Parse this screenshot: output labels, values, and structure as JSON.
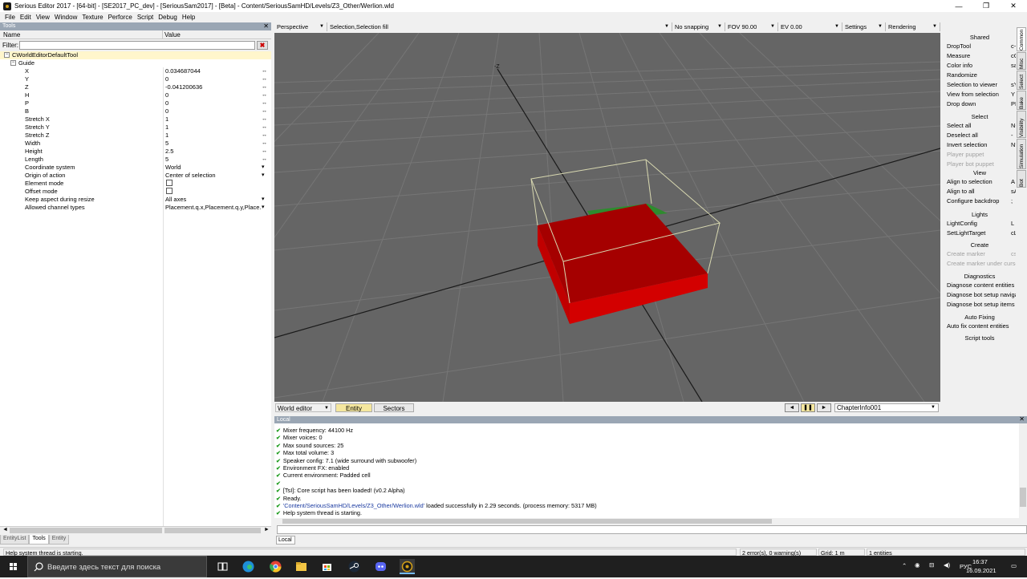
{
  "window": {
    "title": "Serious Editor 2017 - [64-bit] - [SE2017_PC_dev] - [SeriousSam2017] - [Beta] - Content/SeriousSamHD/Levels/Z3_Other/Werlion.wld",
    "minimize": "—",
    "maximize": "❐",
    "close": "✕"
  },
  "menu": [
    "File",
    "Edit",
    "View",
    "Window",
    "Texture",
    "Perforce",
    "Script",
    "Debug",
    "Help"
  ],
  "tools_panel": {
    "title": "Tools",
    "col_name": "Name",
    "col_value": "Value",
    "filter_label": "Filter:",
    "filter_value": "",
    "filter_clear": "✖",
    "root": "CWorldEditorDefaultTool",
    "category": "Guide",
    "properties": [
      {
        "name": "X",
        "value": "0.034687044",
        "arrow": "↔"
      },
      {
        "name": "Y",
        "value": "0",
        "arrow": "↔"
      },
      {
        "name": "Z",
        "value": "-0.041200636",
        "arrow": "↔"
      },
      {
        "name": "H",
        "value": "0",
        "arrow": "↔"
      },
      {
        "name": "P",
        "value": "0",
        "arrow": "↔"
      },
      {
        "name": "B",
        "value": "0",
        "arrow": "↔"
      },
      {
        "name": "Stretch X",
        "value": "1",
        "arrow": "↔"
      },
      {
        "name": "Stretch Y",
        "value": "1",
        "arrow": "↔"
      },
      {
        "name": "Stretch Z",
        "value": "1",
        "arrow": "↔"
      },
      {
        "name": "Width",
        "value": "5",
        "arrow": "↔"
      },
      {
        "name": "Height",
        "value": "2.5",
        "arrow": "↔"
      },
      {
        "name": "Length",
        "value": "5",
        "arrow": "↔"
      },
      {
        "name": "Coordinate system",
        "value": "World",
        "arrow": "▾"
      },
      {
        "name": "Origin of action",
        "value": "Center of selection",
        "arrow": "▾"
      },
      {
        "name": "Element mode",
        "value": "",
        "arrow": "",
        "checkbox": true
      },
      {
        "name": "Offset mode",
        "value": "",
        "arrow": "",
        "checkbox": true
      },
      {
        "name": "Keep aspect during resize",
        "value": "All axes",
        "arrow": "▾"
      },
      {
        "name": "Allowed channel types",
        "value": "Placement.q.x,Placement.q.y,Place...",
        "arrow": "▾"
      }
    ],
    "tabs": [
      "EntityList",
      "Tools",
      "Entity"
    ],
    "active_tab": "Tools"
  },
  "viewport_toolbar": {
    "projection": "Perspective",
    "selection": "Selection,Selection fill",
    "snapping": "No snapping",
    "fov": "FOV 90.00",
    "ev": "EV  0.00",
    "settings": "Settings",
    "rendering": "Rendering",
    "axis_label": "-Z"
  },
  "viewport_bottom": {
    "mode": "World editor",
    "tabs": [
      "Entity",
      "Sectors"
    ],
    "active_tab": "Entity",
    "chapter": "ChapterInfo001",
    "play_prev": "◄",
    "pause": "❚❚",
    "play_next": "►"
  },
  "right_panel": {
    "sections": [
      {
        "header": "Shared",
        "items": [
          {
            "label": "DropTool",
            "shortcut": "c~"
          },
          {
            "label": "Measure",
            "shortcut": "cQ"
          },
          {
            "label": "Color info",
            "shortcut": "sa"
          },
          {
            "label": "Randomize",
            "shortcut": ""
          },
          {
            "label": "Selection to viewer",
            "shortcut": "sY"
          },
          {
            "label": "View from selection",
            "shortcut": "Y"
          },
          {
            "label": "Drop down",
            "shortcut": "PD"
          }
        ]
      },
      {
        "header": "Select",
        "items": [
          {
            "label": "Select all",
            "shortcut": "N+"
          },
          {
            "label": "Deselect all",
            "shortcut": "-"
          },
          {
            "label": "Invert selection",
            "shortcut": "N*"
          },
          {
            "label": "Player puppet",
            "shortcut": "",
            "disabled": true
          },
          {
            "label": "Player bot puppet",
            "shortcut": "",
            "disabled": true
          }
        ]
      },
      {
        "header": "View",
        "items": [
          {
            "label": "Align to selection",
            "shortcut": "A"
          },
          {
            "label": "Align to all",
            "shortcut": "sA"
          },
          {
            "label": "Configure backdrop",
            "shortcut": ";"
          }
        ]
      },
      {
        "header": "Lights",
        "items": [
          {
            "label": "LightConfig",
            "shortcut": "L"
          },
          {
            "label": "SetLightTarget",
            "shortcut": "cL"
          }
        ]
      },
      {
        "header": "Create",
        "items": [
          {
            "label": "Create marker",
            "shortcut": "csC",
            "disabled": true
          },
          {
            "label": "Create marker under cursor",
            "shortcut": "",
            "disabled": true
          }
        ]
      },
      {
        "header": "Diagnostics",
        "items": [
          {
            "label": "Diagnose content entities",
            "shortcut": ""
          },
          {
            "label": "Diagnose bot setup navigation",
            "shortcut": ""
          },
          {
            "label": "Diagnose bot setup items",
            "shortcut": ""
          }
        ]
      },
      {
        "header": "Auto Fixing",
        "items": [
          {
            "label": "Auto fix content entities",
            "shortcut": ""
          }
        ]
      },
      {
        "header": "Script tools",
        "items": []
      }
    ],
    "vertical_tabs": [
      "Common",
      "Misc",
      "Select",
      "Bake",
      "Visibility",
      "Simulation",
      "Bot"
    ]
  },
  "log": {
    "title": "Local",
    "lines": [
      {
        "text": "Mixer frequency: 44100 Hz",
        "check": true
      },
      {
        "text": "Mixer voices: 0",
        "check": true
      },
      {
        "text": "Max sound sources: 25",
        "check": true
      },
      {
        "text": "Max total volume: 3",
        "check": true
      },
      {
        "text": "Speaker config: 7.1 (wide surround with subwoofer)",
        "check": true
      },
      {
        "text": "Environment FX: enabled",
        "check": true
      },
      {
        "text": "Current environment: Padded cell",
        "check": true
      },
      {
        "text": "",
        "check": true
      },
      {
        "text": "[TsI]: Core script has been loaded! (v0.2 Alpha)",
        "check": true
      },
      {
        "text": "Ready.",
        "check": true
      },
      {
        "text": "'Content/SeriousSamHD/Levels/Z3_Other/Werlion.wld' loaded successfully in 2.29 seconds. (process memory: 5317 MB)",
        "check": true,
        "link": "'Content/SeriousSamHD/Levels/Z3_Other/Werlion.wld'"
      },
      {
        "text": "Help system thread is starting.",
        "check": true
      }
    ],
    "tab": "Local"
  },
  "status_bar": {
    "message": "Help system thread is starting.",
    "errors": "2 error(s), 0 warning(s)",
    "grid": "Grid: 1 m",
    "entities": "1 entities"
  },
  "taskbar": {
    "search_placeholder": "Введите здесь текст для поиска",
    "language": "РУС",
    "time": "16:37",
    "date": "16.09.2021"
  },
  "colors": {
    "viewport_bg": "#656565",
    "grid_line": "#767676",
    "box_red": "#a50000",
    "box_outline": "#d8d8b0",
    "panel_header": "#9aa6b4",
    "root_highlight": "#fff6cc",
    "active_tab": "#f5e79e"
  }
}
